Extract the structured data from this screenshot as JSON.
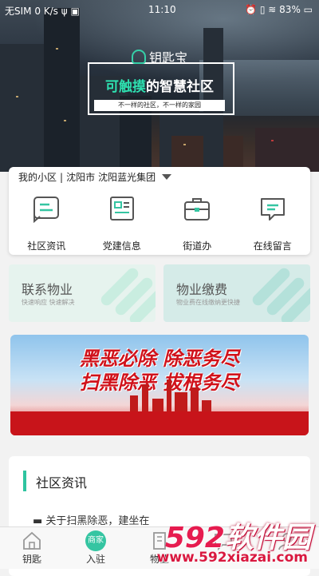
{
  "status_bar": {
    "left": "无SIM  0 K/s ψ ▣",
    "time": "11:10",
    "right": "⏰ ▯ ≋ 83% ▭"
  },
  "hero": {
    "brand": "钥匙宝",
    "slogan_prefix": "可触摸",
    "slogan_suffix": "的智慧社区",
    "sub_slogan": "不一样的社区，不一样的家园"
  },
  "community": {
    "label": "我的小区",
    "separator": "|",
    "city": "沈阳市",
    "group": "沈阳蓝光集团"
  },
  "quick_entries": [
    {
      "label": "社区资讯",
      "icon": "chat-list-icon"
    },
    {
      "label": "党建信息",
      "icon": "document-icon"
    },
    {
      "label": "街道办",
      "icon": "briefcase-icon"
    },
    {
      "label": "在线留言",
      "icon": "message-icon"
    }
  ],
  "services": [
    {
      "title": "联系物业",
      "desc": "快速响应 快速解决",
      "color": "#e6f3ee",
      "stripe": "#c9ede0"
    },
    {
      "title": "物业缴费",
      "desc": "物业费在线缴纳更快捷",
      "color": "#d5ebe8",
      "stripe": "#b4e1da"
    }
  ],
  "banner": {
    "line1": "黑恶必除 除恶务尽",
    "line2": "扫黑除恶 拔根务尽"
  },
  "news": {
    "title": "社区资讯",
    "peek": "▬ 关于扫黑除恶，建坐在"
  },
  "tabs": [
    {
      "label": "钥匙",
      "icon": "house-icon"
    },
    {
      "label": "入驻",
      "icon": "merchant-icon",
      "badge": "商家"
    },
    {
      "label": "物业",
      "icon": "building-icon"
    },
    {
      "label": "",
      "icon": "chat-icon"
    },
    {
      "label": "",
      "icon": "user-icon"
    }
  ],
  "watermark": {
    "brand_num": "592",
    "brand_text": "软件园",
    "url": "www.592xiazai.com"
  },
  "colors": {
    "accent": "#35c5a2",
    "banner_red": "#d0121b"
  }
}
